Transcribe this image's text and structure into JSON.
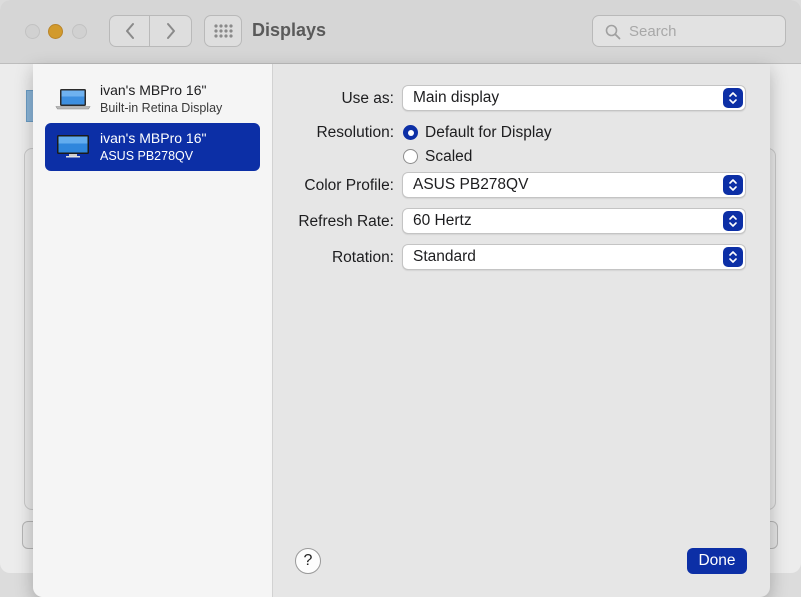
{
  "window": {
    "title": "Displays",
    "search_placeholder": "Search"
  },
  "sidebar": {
    "items": [
      {
        "name": "ivan's MBPro 16\"",
        "subtitle": "Built-in Retina Display",
        "icon": "laptop-icon",
        "selected": false
      },
      {
        "name": "ivan's MBPro 16\"",
        "subtitle": "ASUS PB278QV",
        "icon": "monitor-icon",
        "selected": true
      }
    ]
  },
  "settings": {
    "use_as": {
      "label": "Use as:",
      "value": "Main display"
    },
    "resolution": {
      "label": "Resolution:",
      "options": [
        "Default for Display",
        "Scaled"
      ],
      "selected": "Default for Display"
    },
    "color_profile": {
      "label": "Color Profile:",
      "value": "ASUS PB278QV"
    },
    "refresh_rate": {
      "label": "Refresh Rate:",
      "value": "60 Hertz"
    },
    "rotation": {
      "label": "Rotation:",
      "value": "Standard"
    }
  },
  "footer": {
    "help_label": "?",
    "done_label": "Done"
  },
  "colors": {
    "accent": "#0c2fa6",
    "minimize": "#d29a2c"
  }
}
